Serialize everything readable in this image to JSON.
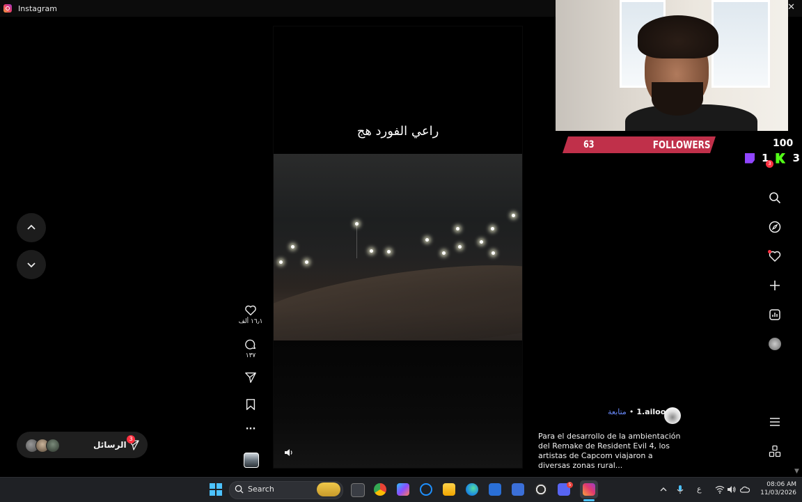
{
  "window": {
    "title": "Instagram",
    "close_glyph": "✕"
  },
  "reel": {
    "caption": "راعي الفورد هج",
    "likes": "١٦٫١ ألف",
    "comments": "١٣٧",
    "more": "···"
  },
  "post": {
    "author": "1.ailoo",
    "separator": "•",
    "follow_label": "متابعة",
    "text": "Para el desarrollo de la ambientación del Remake de Resident Evil 4, los artistas de Capcom viajaron a diversas zonas rural..."
  },
  "messages": {
    "label": "الرسائل",
    "badge": "3"
  },
  "overlay": {
    "followers_count": "63",
    "followers_label": "FOLLOWERS",
    "followers_goal": "100",
    "twitch_count": "1",
    "kick_count": "3"
  },
  "rail": {
    "notifications_badge": "3"
  },
  "taskbar": {
    "search_label": "Search",
    "input_indicator": "ع",
    "time": "08:06 AM",
    "date": "11/03/2026",
    "discord_badge": "5"
  },
  "colors": {
    "accent": "#4cc2ff",
    "like_red": "#ff3040",
    "followers_bar": "#c0304a",
    "twitch": "#9146ff",
    "kick": "#53fc18",
    "follow_link": "#6b8cff"
  }
}
